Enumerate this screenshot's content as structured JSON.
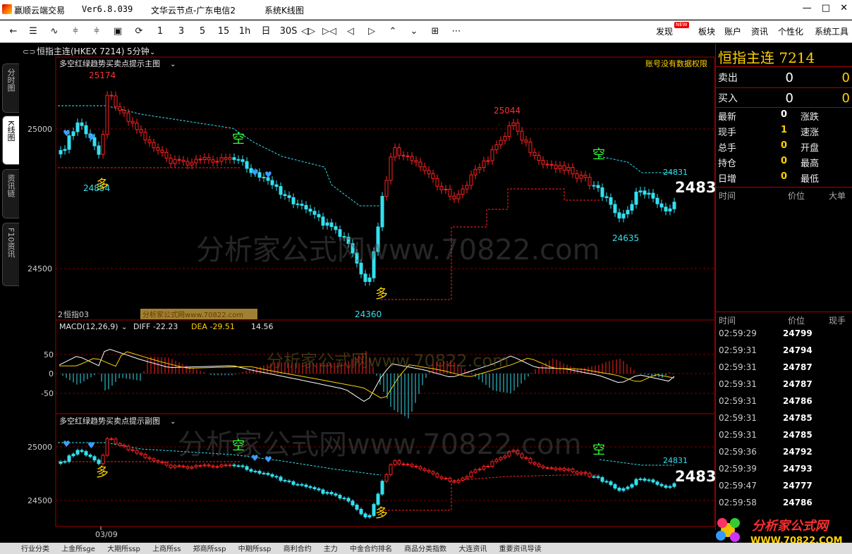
{
  "window": {
    "app_name": "赢顺云端交易",
    "version": "Ver6.8.039",
    "server": "文华云节点-广东电信2",
    "view_name": "系统K线图",
    "controls": [
      "—",
      "□",
      "✕"
    ]
  },
  "toolbar": {
    "buttons": [
      "←",
      "☰",
      "∿",
      "⫩",
      "⫩",
      "▣",
      "⟳",
      "1",
      "3",
      "5",
      "15",
      "1h",
      "日",
      "30S",
      "◁▷",
      "▷◁",
      "◁",
      "▷",
      "⌃",
      "⌄",
      "⊞",
      "⋯"
    ],
    "menus": [
      "发现",
      "板块",
      "账户",
      "资讯",
      "个性化",
      "系统工具"
    ],
    "new_badge": "NEW"
  },
  "left_tabs": [
    {
      "label": "分时图",
      "active": false
    },
    {
      "label": "K线图",
      "active": true
    },
    {
      "label": "资讯链",
      "active": false
    },
    {
      "label": "F10资讯",
      "active": false
    }
  ],
  "main_chart": {
    "symbol": "恒指主连(HKEX 7214)",
    "period": "5分钟",
    "indicator_name": "多空红绿趋势买卖点提示主图",
    "notice": "账号没有数据权限",
    "y_ticks": [
      "25000",
      "24500"
    ],
    "labels": {
      "high_left": "25174",
      "low_left": "24854",
      "high_right": "25044",
      "low_mid": "24360",
      "low_right": "24635",
      "line_right": "24831",
      "last_price": "2483",
      "long": "多",
      "short": "空"
    },
    "sub_label": "恒指03",
    "sub_prefix": "2"
  },
  "macd_chart": {
    "label": "MACD(12,26,9)",
    "diff": "DIFF -22.23",
    "dea": "DEA -29.51",
    "macd": "14.56",
    "y_ticks": [
      "50",
      "0",
      "-50"
    ]
  },
  "sub_chart": {
    "indicator_name": "多空红绿趋势买卖点提示副图",
    "y_ticks": [
      "25000",
      "24500"
    ],
    "labels": {
      "line_right": "24831",
      "last_price": "2483",
      "long": "多",
      "short": "空"
    },
    "date_label": "03/09"
  },
  "quote_panel": {
    "title": "恒指主连 7214",
    "sell_label": "卖出",
    "sell_price": "0",
    "sell_qty": "0",
    "buy_label": "买入",
    "buy_price": "0",
    "buy_qty": "0",
    "stats": [
      {
        "label": "最新",
        "value": "0",
        "label2": "涨跌"
      },
      {
        "label": "现手",
        "value": "1",
        "label2": "速涨"
      },
      {
        "label": "总手",
        "value": "0",
        "label2": "开盘"
      },
      {
        "label": "持仓",
        "value": "0",
        "label2": "最高"
      },
      {
        "label": "日增",
        "value": "0",
        "label2": "最低"
      }
    ],
    "col_headers": [
      "时间",
      "价位",
      "大单"
    ],
    "tick_headers": [
      "时间",
      "价位",
      "现手"
    ],
    "ticks": [
      {
        "time": "02:59:29",
        "price": "24799"
      },
      {
        "time": "02:59:31",
        "price": "24794"
      },
      {
        "time": "02:59:31",
        "price": "24787"
      },
      {
        "time": "02:59:31",
        "price": "24787"
      },
      {
        "time": "02:59:31",
        "price": "24786"
      },
      {
        "time": "02:59:31",
        "price": "24785"
      },
      {
        "time": "02:59:31",
        "price": "24785"
      },
      {
        "time": "02:59:36",
        "price": "24792"
      },
      {
        "time": "02:59:39",
        "price": "24793"
      },
      {
        "time": "02:59:47",
        "price": "24777"
      },
      {
        "time": "02:59:58",
        "price": "24786"
      }
    ]
  },
  "watermark": {
    "text": "分析家公式网www.70822.com",
    "small_tag": "分析家公式网www.70822.com",
    "logo_title": "分析家公式网",
    "logo_url": "WWW.70822.COM"
  },
  "statusbar": {
    "items": [
      "行业分类",
      "上金所sge",
      "大期所ssp",
      "上商所ss",
      "郑商所ssp",
      "中期所ssp",
      "商利合约",
      "主力",
      "中金合约排名",
      "商品分类指数",
      "大连资讯",
      "重要资讯导读"
    ]
  },
  "colors": {
    "up": "#ff2222",
    "down": "#33e0f0",
    "gold": "#ffd200",
    "panel_border": "#a00000"
  }
}
